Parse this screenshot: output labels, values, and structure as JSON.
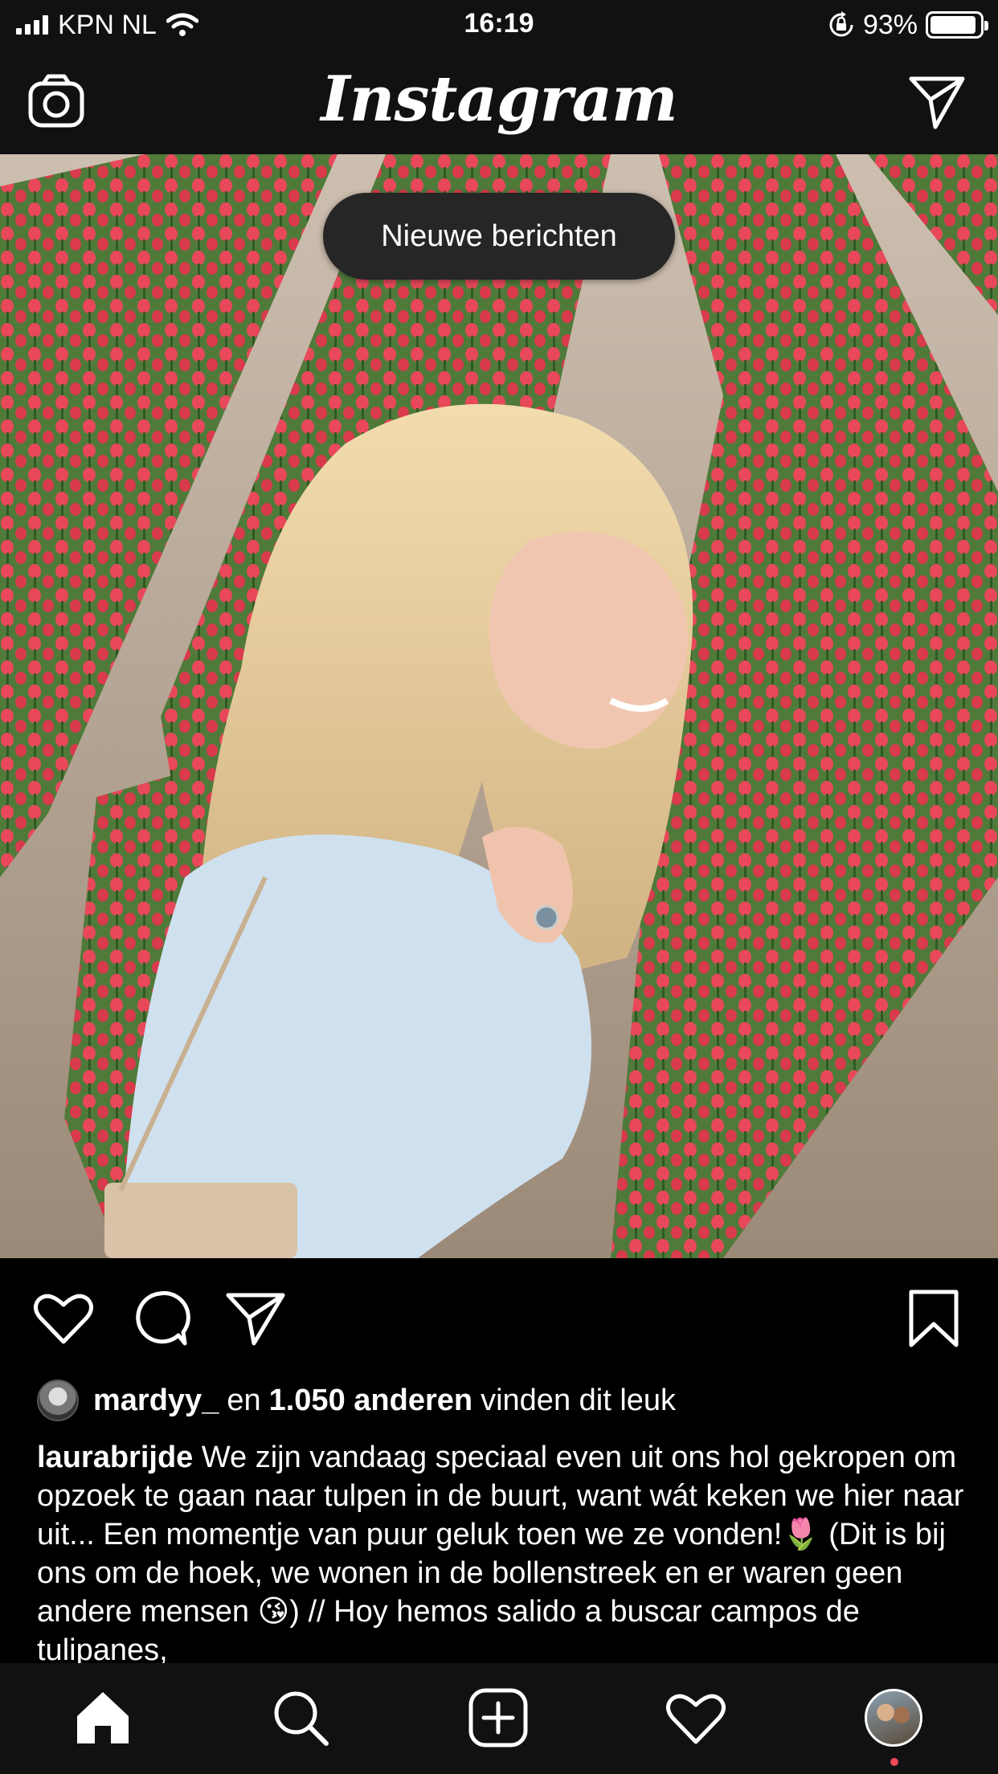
{
  "status_bar": {
    "carrier": "KPN NL",
    "time": "16:19",
    "battery": "93%",
    "battery_level": 0.93
  },
  "header": {
    "logo": "Instagram",
    "left_icon": "camera-icon",
    "right_icon": "direct-message-icon"
  },
  "feed": {
    "new_posts_pill": "Nieuwe berichten"
  },
  "post": {
    "liked_by_user": "mardyy_",
    "liked_en": "en",
    "liked_others": "1.050 anderen",
    "liked_suffix": "vinden dit leuk",
    "author": "laurabrijde",
    "caption_text": "We zijn vandaag speciaal even uit ons hol gekropen om opzoek te gaan naar tulpen in de buurt, want wát keken we hier naar uit... Een momentje van puur geluk toen we ze vonden!🌷 (Dit is bij ons om de hoek, we wonen in de bollenstreek en er waren geen andere mensen 😘) // Hoy hemos salido a buscar campos de tulipanes,"
  },
  "bottom_nav": {
    "items": [
      "home-icon",
      "search-icon",
      "new-post-icon",
      "activity-icon",
      "profile-avatar"
    ],
    "notification_color": "#ed4956"
  }
}
